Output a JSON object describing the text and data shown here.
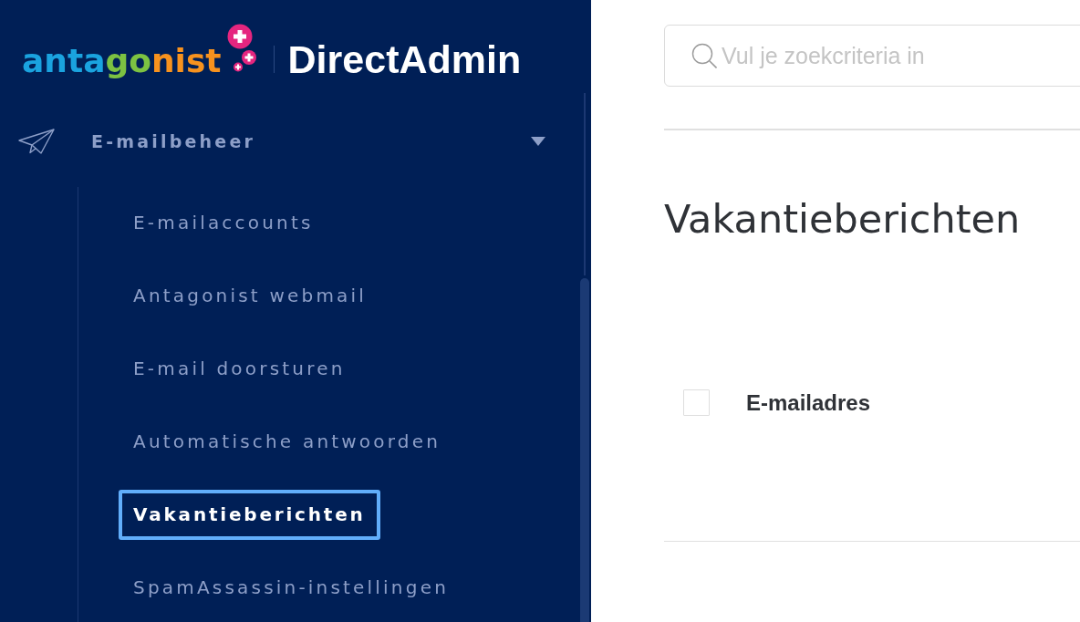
{
  "logo": {
    "brand": [
      {
        "text": "anta",
        "color": "#1aa3df"
      },
      {
        "text": "go",
        "color": "#7cc242"
      },
      {
        "text": "nist",
        "color": "#f7921e"
      }
    ],
    "product": "DirectAdmin"
  },
  "sidebar": {
    "group": {
      "label": "E-mailbeheer",
      "expanded": true,
      "children": [
        {
          "label": "E-mailaccounts",
          "selected": false
        },
        {
          "label": "Antagonist webmail",
          "selected": false
        },
        {
          "label": "E-mail doorsturen",
          "selected": false
        },
        {
          "label": "Automatische antwoorden",
          "selected": false
        },
        {
          "label": "Vakantieberichten",
          "selected": true
        },
        {
          "label": "SpamAssassin-instellingen",
          "selected": false
        }
      ]
    }
  },
  "search": {
    "placeholder": "Vul je zoekcriteria in"
  },
  "page_title": "Vakantieberichten",
  "table": {
    "select_all": {
      "checked": false
    },
    "columns": [
      "E-mailadres"
    ]
  }
}
